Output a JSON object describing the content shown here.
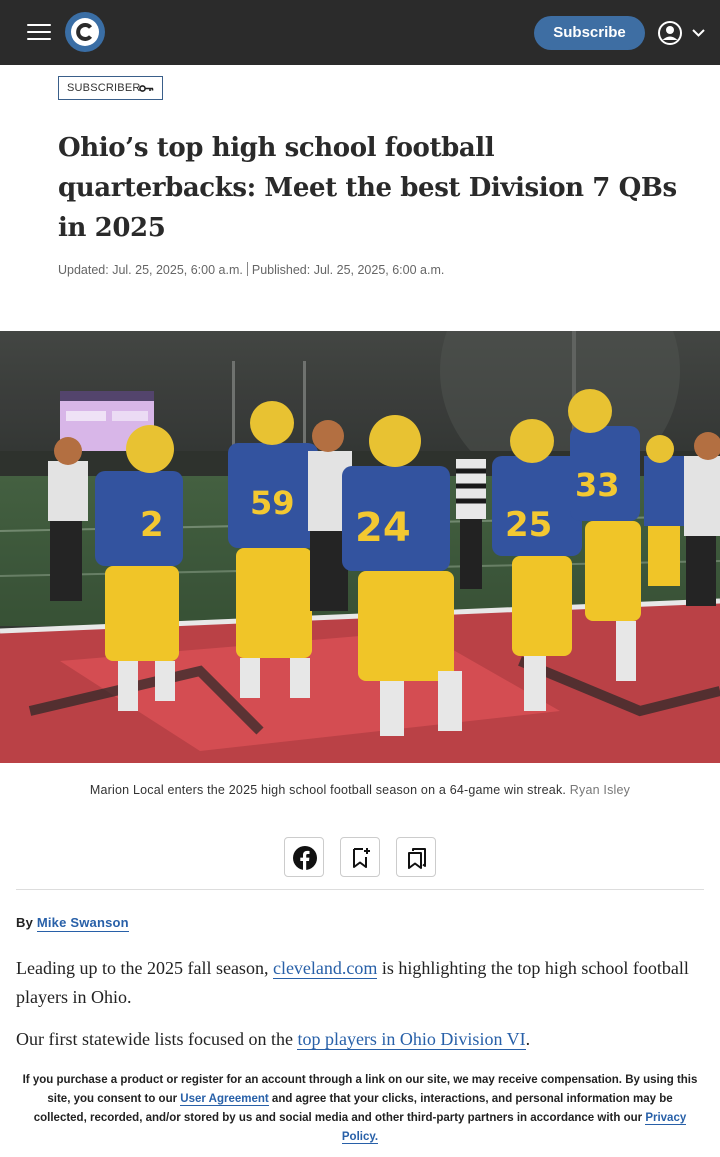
{
  "header": {
    "logo_icon": "cleveland-c-logo",
    "menu_icon": "hamburger-menu-icon",
    "subscribe_label": "Subscribe",
    "account_icon": "user-circle-icon",
    "brand_color": "#3e6ea3",
    "bar_color": "#2b2b2b"
  },
  "article": {
    "badge": "SUBSCRIBER",
    "badge_icon": "key-icon",
    "headline": "Ohio’s top high school football quarterbacks: Meet the best Division 7 QBs in 2025",
    "updated": "Updated: Jul. 25, 2025, 6:00 a.m.",
    "published": "Published: Jul. 25, 2025, 6:00 a.m.",
    "image_alt": "Football players in blue and gold uniforms celebrating on a red end zone at night",
    "caption": "Marion Local enters the 2025 high school football season on a 64-game win streak.",
    "caption_credit": "Ryan Isley",
    "share": {
      "facebook_icon": "facebook-icon",
      "bookmark_add_icon": "bookmark-add-icon",
      "bookmarks_icon": "bookmarks-icon"
    },
    "byline_prefix": "By",
    "author": "Mike Swanson",
    "p1_before": "Leading up to the 2025 fall season,",
    "p1_link": "cleveland.com",
    "p1_after": "is highlighting the top high school football players in Ohio.",
    "p2_before": "Our first statewide lists focused on the",
    "p2_link": "top players in Ohio Division VI",
    "p2_after": "."
  },
  "disclaimer": {
    "text1": "If you purchase a product or register for an account through a link on our site, we may receive compensation. By using this site, you consent to our",
    "link1": "User Agreement",
    "text2": "and agree that your clicks, interactions, and personal information may be collected, recorded, and/or stored by us and social media and other third-party partners in accordance with our",
    "link2": "Privacy Policy."
  }
}
